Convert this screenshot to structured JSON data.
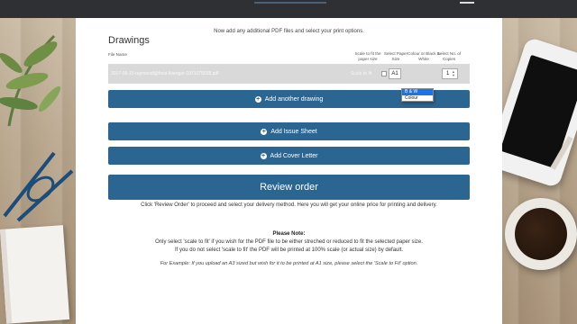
{
  "header": {
    "menu_icon": "hamburger-menu-icon"
  },
  "page": {
    "instruction": "Now add any additional PDF files and select your print options.",
    "section_title": "Drawings"
  },
  "table": {
    "columns": {
      "file_name": "File Name",
      "scale": "Scale to fit the paper size",
      "paper": "Select Paper Size",
      "colour": "Colour or Black & White",
      "copies": "Select No. of Copies"
    },
    "row": {
      "file_name": "2017-05-15-raymondl@host-fiverigor-1971075028.pdf",
      "scale_label": "Scale to fit",
      "scale_checked": false,
      "paper_size": "A1",
      "colour_options": [
        "B & W",
        "Colour"
      ],
      "colour_selected": "B & W",
      "copies": "1"
    }
  },
  "buttons": {
    "add_drawing": "Add another drawing",
    "add_issue_sheet": "Add Issue Sheet",
    "add_cover_letter": "Add Cover Letter",
    "review_order": "Review order"
  },
  "help": {
    "review": "Click 'Review Order' to proceed and select your delivery method. Here you will get your online price for printing and delivery.",
    "note_title": "Please Note:",
    "note_line1": "Only select 'scale to fit' if you wish for the PDF file to be either streched or reduced to fit the selected paper size.",
    "note_line2": "If you do not select 'scale to fit' the PDF will be printed at 100% scale (or actual size) by default.",
    "example": "For Example: If you upload an A3 sized but wish for it to be printed at A1 size, please select the 'Scale to Fit' option."
  },
  "colors": {
    "primary_button": "#2b6591",
    "topbar": "#2e3033",
    "row_background": "#d9d9d9"
  }
}
